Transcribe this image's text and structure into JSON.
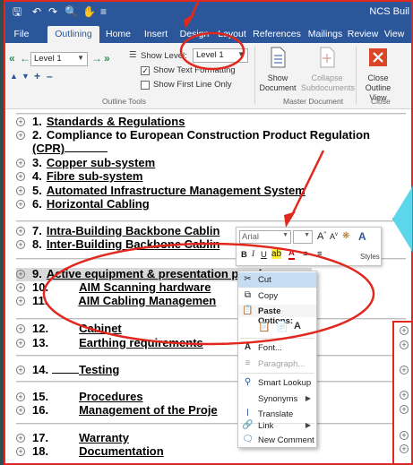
{
  "app": {
    "title": "NCS Buil",
    "qat_icons": [
      "save-icon",
      "undo-icon",
      "redo-icon",
      "print-preview-icon",
      "touch-mode-icon",
      "customize-qat-icon"
    ]
  },
  "tabs": [
    "File",
    "Outlining",
    "Home",
    "Insert",
    "Design",
    "Layout",
    "References",
    "Mailings",
    "Review",
    "View"
  ],
  "active_tab": "Outlining",
  "ribbon": {
    "outline_tools": {
      "level_value": "Level 1",
      "show_level_label": "Show Level:",
      "show_level_value": "Level 1",
      "show_text_formatting": "Show Text Formatting",
      "show_text_formatting_checked": true,
      "show_first_line_only": "Show First Line Only",
      "show_first_line_only_checked": false,
      "group_label": "Outline Tools"
    },
    "master_document": {
      "show_document": "Show Document",
      "collapse_subdocuments": "Collapse Subdocuments",
      "group_label": "Master Document"
    },
    "close": {
      "close_outline_view": "Close Outline View",
      "group_label": "Close"
    }
  },
  "outline": [
    {
      "num": "1.",
      "text": "Standards & Regulations"
    },
    {
      "num": "2.",
      "text": "Compliance to European Construction Product Regulation",
      "cont": "(CPR)"
    },
    {
      "num": "3.",
      "text": "Copper sub-system"
    },
    {
      "num": "4.",
      "text": "Fibre sub-system"
    },
    {
      "num": "5.",
      "text": "Automated Infrastructure Management System"
    },
    {
      "num": "6.",
      "text": "Horizontal Cabling"
    },
    {
      "num": "7.",
      "text": "Intra-Building Backbone Cablin"
    },
    {
      "num": "8.",
      "text": "Inter-Building Backbone Cablin"
    },
    {
      "num": "9.",
      "text": "Active equipment & presentation panels"
    },
    {
      "num": "10.",
      "text": "AIM Scanning hardware"
    },
    {
      "num": "11.",
      "text": "AIM Cabling Managemen"
    },
    {
      "num": "12.",
      "text": "Cabinet"
    },
    {
      "num": "13.",
      "text": "Earthing requirements"
    },
    {
      "num": "14.",
      "text": "Testing"
    },
    {
      "num": "15.",
      "text": "Procedures"
    },
    {
      "num": "16.",
      "text": "Management of the Proje"
    },
    {
      "num": "17.",
      "text": "Warranty"
    },
    {
      "num": "18.",
      "text": "Documentation"
    }
  ],
  "mini_toolbar": {
    "font": "Arial",
    "styles": "Styles"
  },
  "context_menu": {
    "cut": "Cut",
    "copy": "Copy",
    "paste_options": "Paste Options:",
    "font": "Font...",
    "paragraph": "Paragraph...",
    "smart_lookup": "Smart Lookup",
    "synonyms": "Synonyms",
    "translate": "Translate",
    "link": "Link",
    "new_comment": "New Comment"
  },
  "colors": {
    "title_bar": "#2b579a",
    "ribbon": "#f3f3f3",
    "annotation": "#e0281e",
    "close_button": "#d9472b",
    "callout": "#5cd6ea"
  }
}
